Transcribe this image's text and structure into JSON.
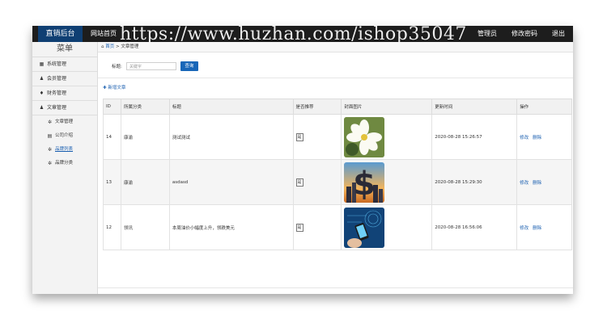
{
  "header": {
    "brand": "直销后台",
    "home_link": "网站首页",
    "right_links": [
      "管理员",
      "修改密码",
      "退出"
    ]
  },
  "watermark": "https://www.huzhan.com/ishop35047",
  "sidebar": {
    "title": "菜单",
    "items": [
      {
        "label": "系统管理",
        "icon": "settings-icon"
      },
      {
        "label": "会员管理",
        "icon": "user-icon"
      },
      {
        "label": "财务管理",
        "icon": "finance-icon"
      },
      {
        "label": "文章管理",
        "icon": "user-icon"
      }
    ],
    "sub_items": [
      {
        "label": "文章管理",
        "icon": "gear-icon"
      },
      {
        "label": "公司介绍",
        "icon": "building-icon"
      },
      {
        "label": "品牌列表",
        "icon": "gear-icon",
        "active": true
      },
      {
        "label": "品牌分类",
        "icon": "gear-icon"
      }
    ]
  },
  "breadcrumb": {
    "home": "首页",
    "separator": ">",
    "current": "文章管理"
  },
  "search": {
    "label": "标题:",
    "placeholder": "关键字",
    "button": "查询"
  },
  "add_button": "新增文章",
  "table": {
    "headers": [
      "ID",
      "所属分类",
      "标题",
      "是否推荐",
      "封面图片",
      "更新时间",
      "操作"
    ],
    "rows": [
      {
        "id": "14",
        "category": "康渝",
        "title": "测试测试",
        "recommend": "是",
        "image": "flower-image",
        "updated": "2020-08-28 15:26:57",
        "ops": [
          "修改",
          "删除"
        ]
      },
      {
        "id": "13",
        "category": "康渝",
        "title": "asdasd",
        "recommend": "是",
        "image": "dollar-city-image",
        "updated": "2020-08-28 15:29:30",
        "ops": [
          "修改",
          "删除"
        ]
      },
      {
        "id": "12",
        "category": "领讯",
        "title": "本周油价小幅度上升，领跌美元",
        "recommend": "是",
        "image": "phone-tech-image",
        "updated": "2020-08-28 16:56:06",
        "ops": [
          "修改",
          "删除"
        ]
      }
    ]
  }
}
